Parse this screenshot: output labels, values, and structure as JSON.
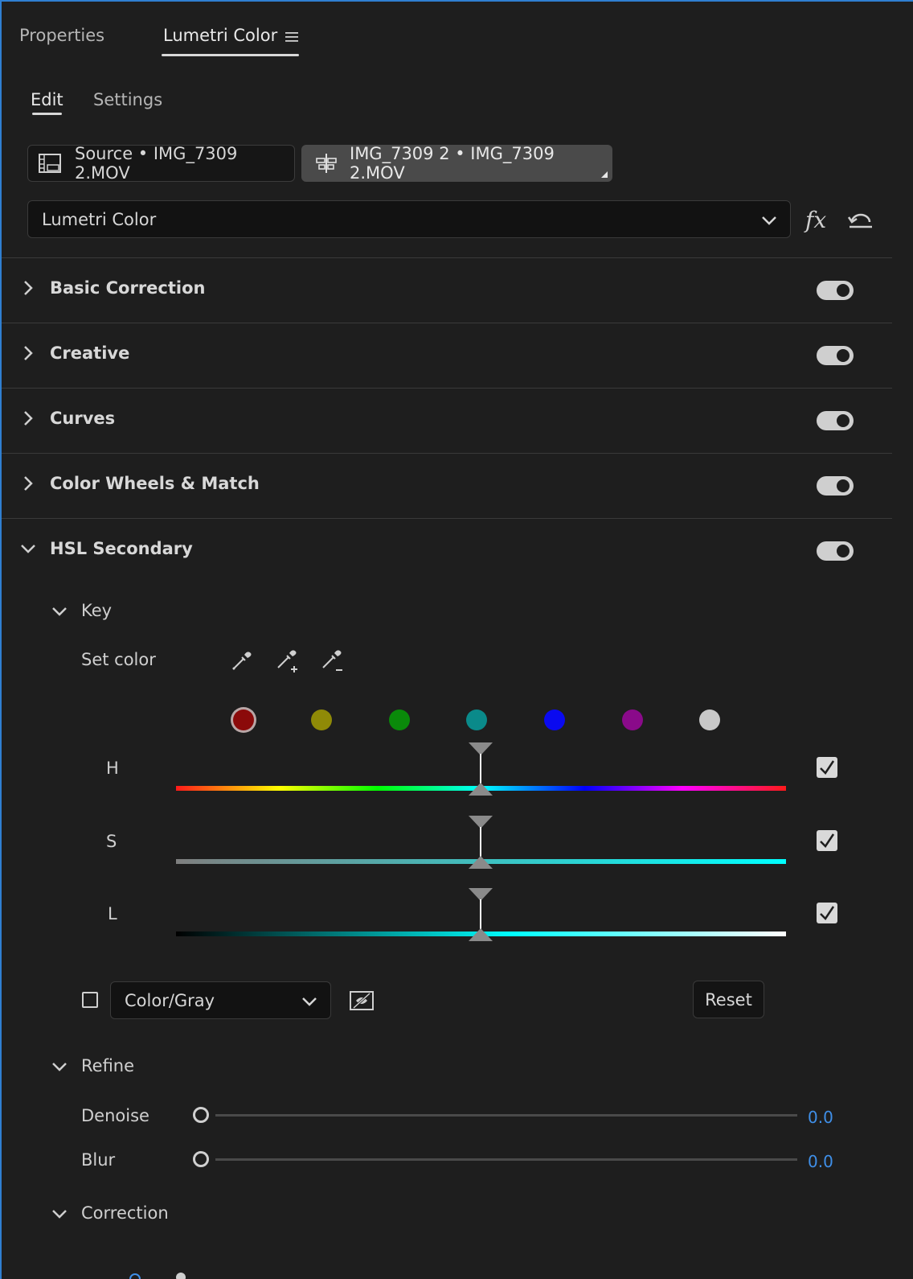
{
  "panel_tabs": [
    {
      "label": "Properties",
      "active": false
    },
    {
      "label": "Lumetri Color",
      "active": true
    }
  ],
  "sub_tabs": [
    {
      "label": "Edit",
      "active": true
    },
    {
      "label": "Settings",
      "active": false
    }
  ],
  "clip_buttons": {
    "source": "Source • IMG_7309 2.MOV",
    "sequence": "IMG_7309 2 • IMG_7309 2.MOV"
  },
  "effect_dropdown": {
    "selected": "Lumetri Color"
  },
  "sections": [
    {
      "title": "Basic Correction",
      "expanded": false,
      "enabled": true
    },
    {
      "title": "Creative",
      "expanded": false,
      "enabled": true
    },
    {
      "title": "Curves",
      "expanded": false,
      "enabled": true
    },
    {
      "title": "Color Wheels & Match",
      "expanded": false,
      "enabled": true
    },
    {
      "title": "HSL Secondary",
      "expanded": true,
      "enabled": true
    }
  ],
  "hsl": {
    "key": {
      "title": "Key",
      "set_color_label": "Set color",
      "swatches": [
        "#8b0a0a",
        "#8f8a07",
        "#0a8a0a",
        "#0a8a8a",
        "#0a0af0",
        "#8a0a8a",
        "#c8c8c8"
      ],
      "sliders": [
        {
          "label": "H",
          "checked": true,
          "position": 0.5
        },
        {
          "label": "S",
          "checked": true,
          "position": 0.5
        },
        {
          "label": "L",
          "checked": true,
          "position": 0.5
        }
      ],
      "display_mode": "Color/Gray",
      "display_checked": false,
      "reset_label": "Reset"
    },
    "refine": {
      "title": "Refine",
      "sliders": [
        {
          "label": "Denoise",
          "value": "0.0"
        },
        {
          "label": "Blur",
          "value": "0.0"
        }
      ]
    },
    "correction": {
      "title": "Correction"
    }
  },
  "colors": {
    "accent_blue": "#3f8fe8",
    "focus_border": "#2f7fd1"
  }
}
